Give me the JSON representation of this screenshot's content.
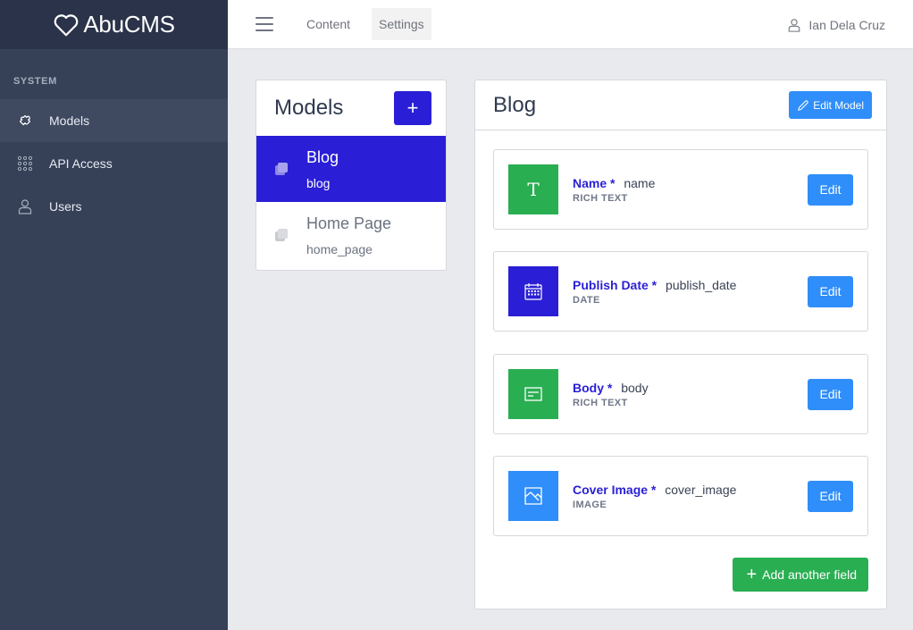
{
  "brand": {
    "name": "AbuCMS",
    "icon": "heart-icon"
  },
  "sidebar": {
    "section": "SYSTEM",
    "items": [
      {
        "label": "Models",
        "icon": "puzzle-icon",
        "active": true
      },
      {
        "label": "API Access",
        "icon": "grid-dots-icon",
        "active": false
      },
      {
        "label": "Users",
        "icon": "user-icon",
        "active": false
      }
    ]
  },
  "topbar": {
    "menu_icon": "hamburger-icon",
    "links": [
      {
        "label": "Content",
        "active": false
      },
      {
        "label": "Settings",
        "active": true
      }
    ],
    "user": {
      "name": "Ian Dela Cruz",
      "icon": "user-icon"
    }
  },
  "models": {
    "title": "Models",
    "add_label": "+",
    "items": [
      {
        "name": "Blog",
        "slug": "blog",
        "active": true,
        "icon": "copy-icon"
      },
      {
        "name": "Home Page",
        "slug": "home_page",
        "active": false,
        "icon": "copy-icon"
      }
    ]
  },
  "model_detail": {
    "title": "Blog",
    "edit_model_label": "Edit Model",
    "fields": [
      {
        "label": "Name *",
        "key": "name",
        "type": "RICH TEXT",
        "icon": "text-t-icon",
        "color": "#2aae52",
        "edit_label": "Edit"
      },
      {
        "label": "Publish Date *",
        "key": "publish_date",
        "type": "DATE",
        "icon": "calendar-icon",
        "color": "#2a1fd6",
        "edit_label": "Edit"
      },
      {
        "label": "Body *",
        "key": "body",
        "type": "RICH TEXT",
        "icon": "text-block-icon",
        "color": "#2aae52",
        "edit_label": "Edit"
      },
      {
        "label": "Cover Image *",
        "key": "cover_image",
        "type": "IMAGE",
        "icon": "image-icon",
        "color": "#2f8ef9",
        "edit_label": "Edit"
      }
    ],
    "add_field_label": "Add another field"
  },
  "colors": {
    "primary": "#2a1fd6",
    "accent_blue": "#2f8ef9",
    "success": "#2aae52",
    "sidebar_bg": "#364158",
    "brand_bg": "#2a3349"
  }
}
